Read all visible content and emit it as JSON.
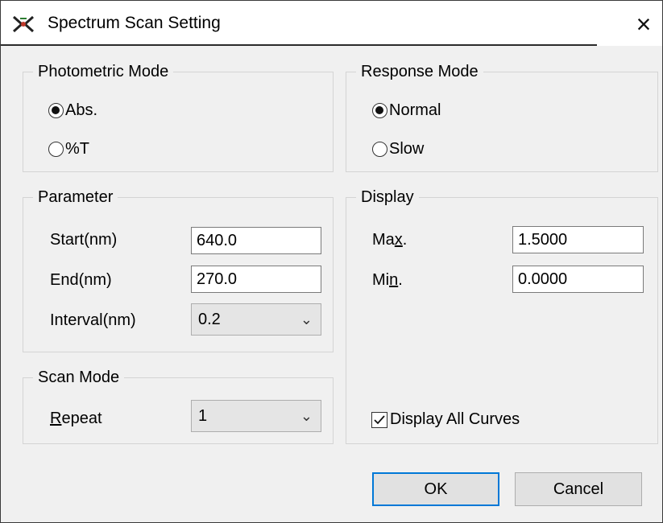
{
  "window": {
    "title": "Spectrum Scan Setting",
    "close_icon": "×"
  },
  "photometric_mode": {
    "label": "Photometric Mode",
    "options": [
      {
        "label": "Abs.",
        "checked": true
      },
      {
        "label": "%T",
        "checked": false
      }
    ]
  },
  "response_mode": {
    "label": "Response Mode",
    "options": [
      {
        "label": "Normal",
        "checked": true
      },
      {
        "label": "Slow",
        "checked": false
      }
    ]
  },
  "parameter": {
    "label": "Parameter",
    "start_label": "Start(nm)",
    "start_value": "640.0",
    "end_label": "End(nm)",
    "end_value": "270.0",
    "interval_label": "Interval(nm)",
    "interval_value": "0.2"
  },
  "display": {
    "label": "Display",
    "max_label_pre": "Ma",
    "max_label_u": "x",
    "max_label_post": ".",
    "max_value": "1.5000",
    "min_label_pre": "Mi",
    "min_label_u": "n",
    "min_label_post": ".",
    "min_value": "0.0000",
    "all_curves_label": "Display All Curves",
    "all_curves_checked": true
  },
  "scan_mode": {
    "label": "Scan Mode",
    "repeat_label_u": "R",
    "repeat_label_rest": "epeat",
    "repeat_value": "1"
  },
  "buttons": {
    "ok": "OK",
    "cancel": "Cancel"
  }
}
